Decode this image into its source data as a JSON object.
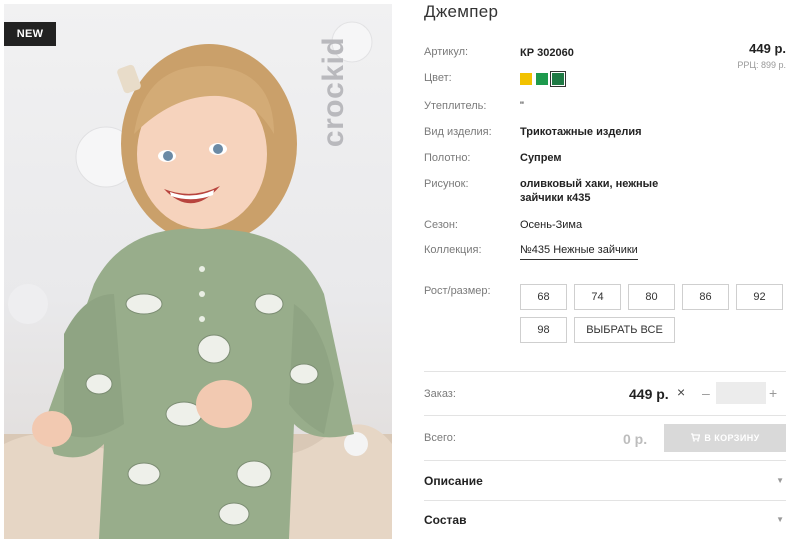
{
  "badge": "NEW",
  "brand": "crockid",
  "product": {
    "title": "Джемпер",
    "price": "449 р.",
    "rrp": "РРЦ: 899 р."
  },
  "attributes": [
    {
      "label": "Артикул:",
      "value": "КР 302060"
    },
    {
      "label": "Цвет:",
      "value": ""
    },
    {
      "label": "Утеплитель:",
      "value": "\""
    },
    {
      "label": "Вид изделия:",
      "value": "Трикотажные изделия"
    },
    {
      "label": "Полотно:",
      "value": "Супрем"
    },
    {
      "label": "Рисунок:",
      "value": "оливковый хаки, нежные зайчики к435"
    },
    {
      "label": "Сезон:",
      "value": "Осень-Зима"
    },
    {
      "label": "Коллекция:",
      "value": "№435 Нежные зайчики"
    }
  ],
  "colors": [
    {
      "name": "yellow",
      "hex": "#f2c200"
    },
    {
      "name": "green",
      "hex": "#1e9a4d"
    },
    {
      "name": "dark-green",
      "hex": "#1f7a45",
      "selected": true
    }
  ],
  "sizes": {
    "label": "Рост/размер:",
    "options": [
      "68",
      "74",
      "80",
      "86",
      "92",
      "98"
    ],
    "select_all": "ВЫБРАТЬ ВСЕ"
  },
  "order": {
    "label": "Заказ:",
    "price": "449 р.",
    "times": "×",
    "minus": "–",
    "plus": "+",
    "quantity": ""
  },
  "total": {
    "label": "Всего:",
    "value": "0 р.",
    "cart_button": "В КОРЗИНУ"
  },
  "accordion": [
    {
      "label": "Описание"
    },
    {
      "label": "Состав"
    }
  ],
  "icons": {
    "cart": "cart-icon",
    "arrow": "chevron-down-icon"
  }
}
